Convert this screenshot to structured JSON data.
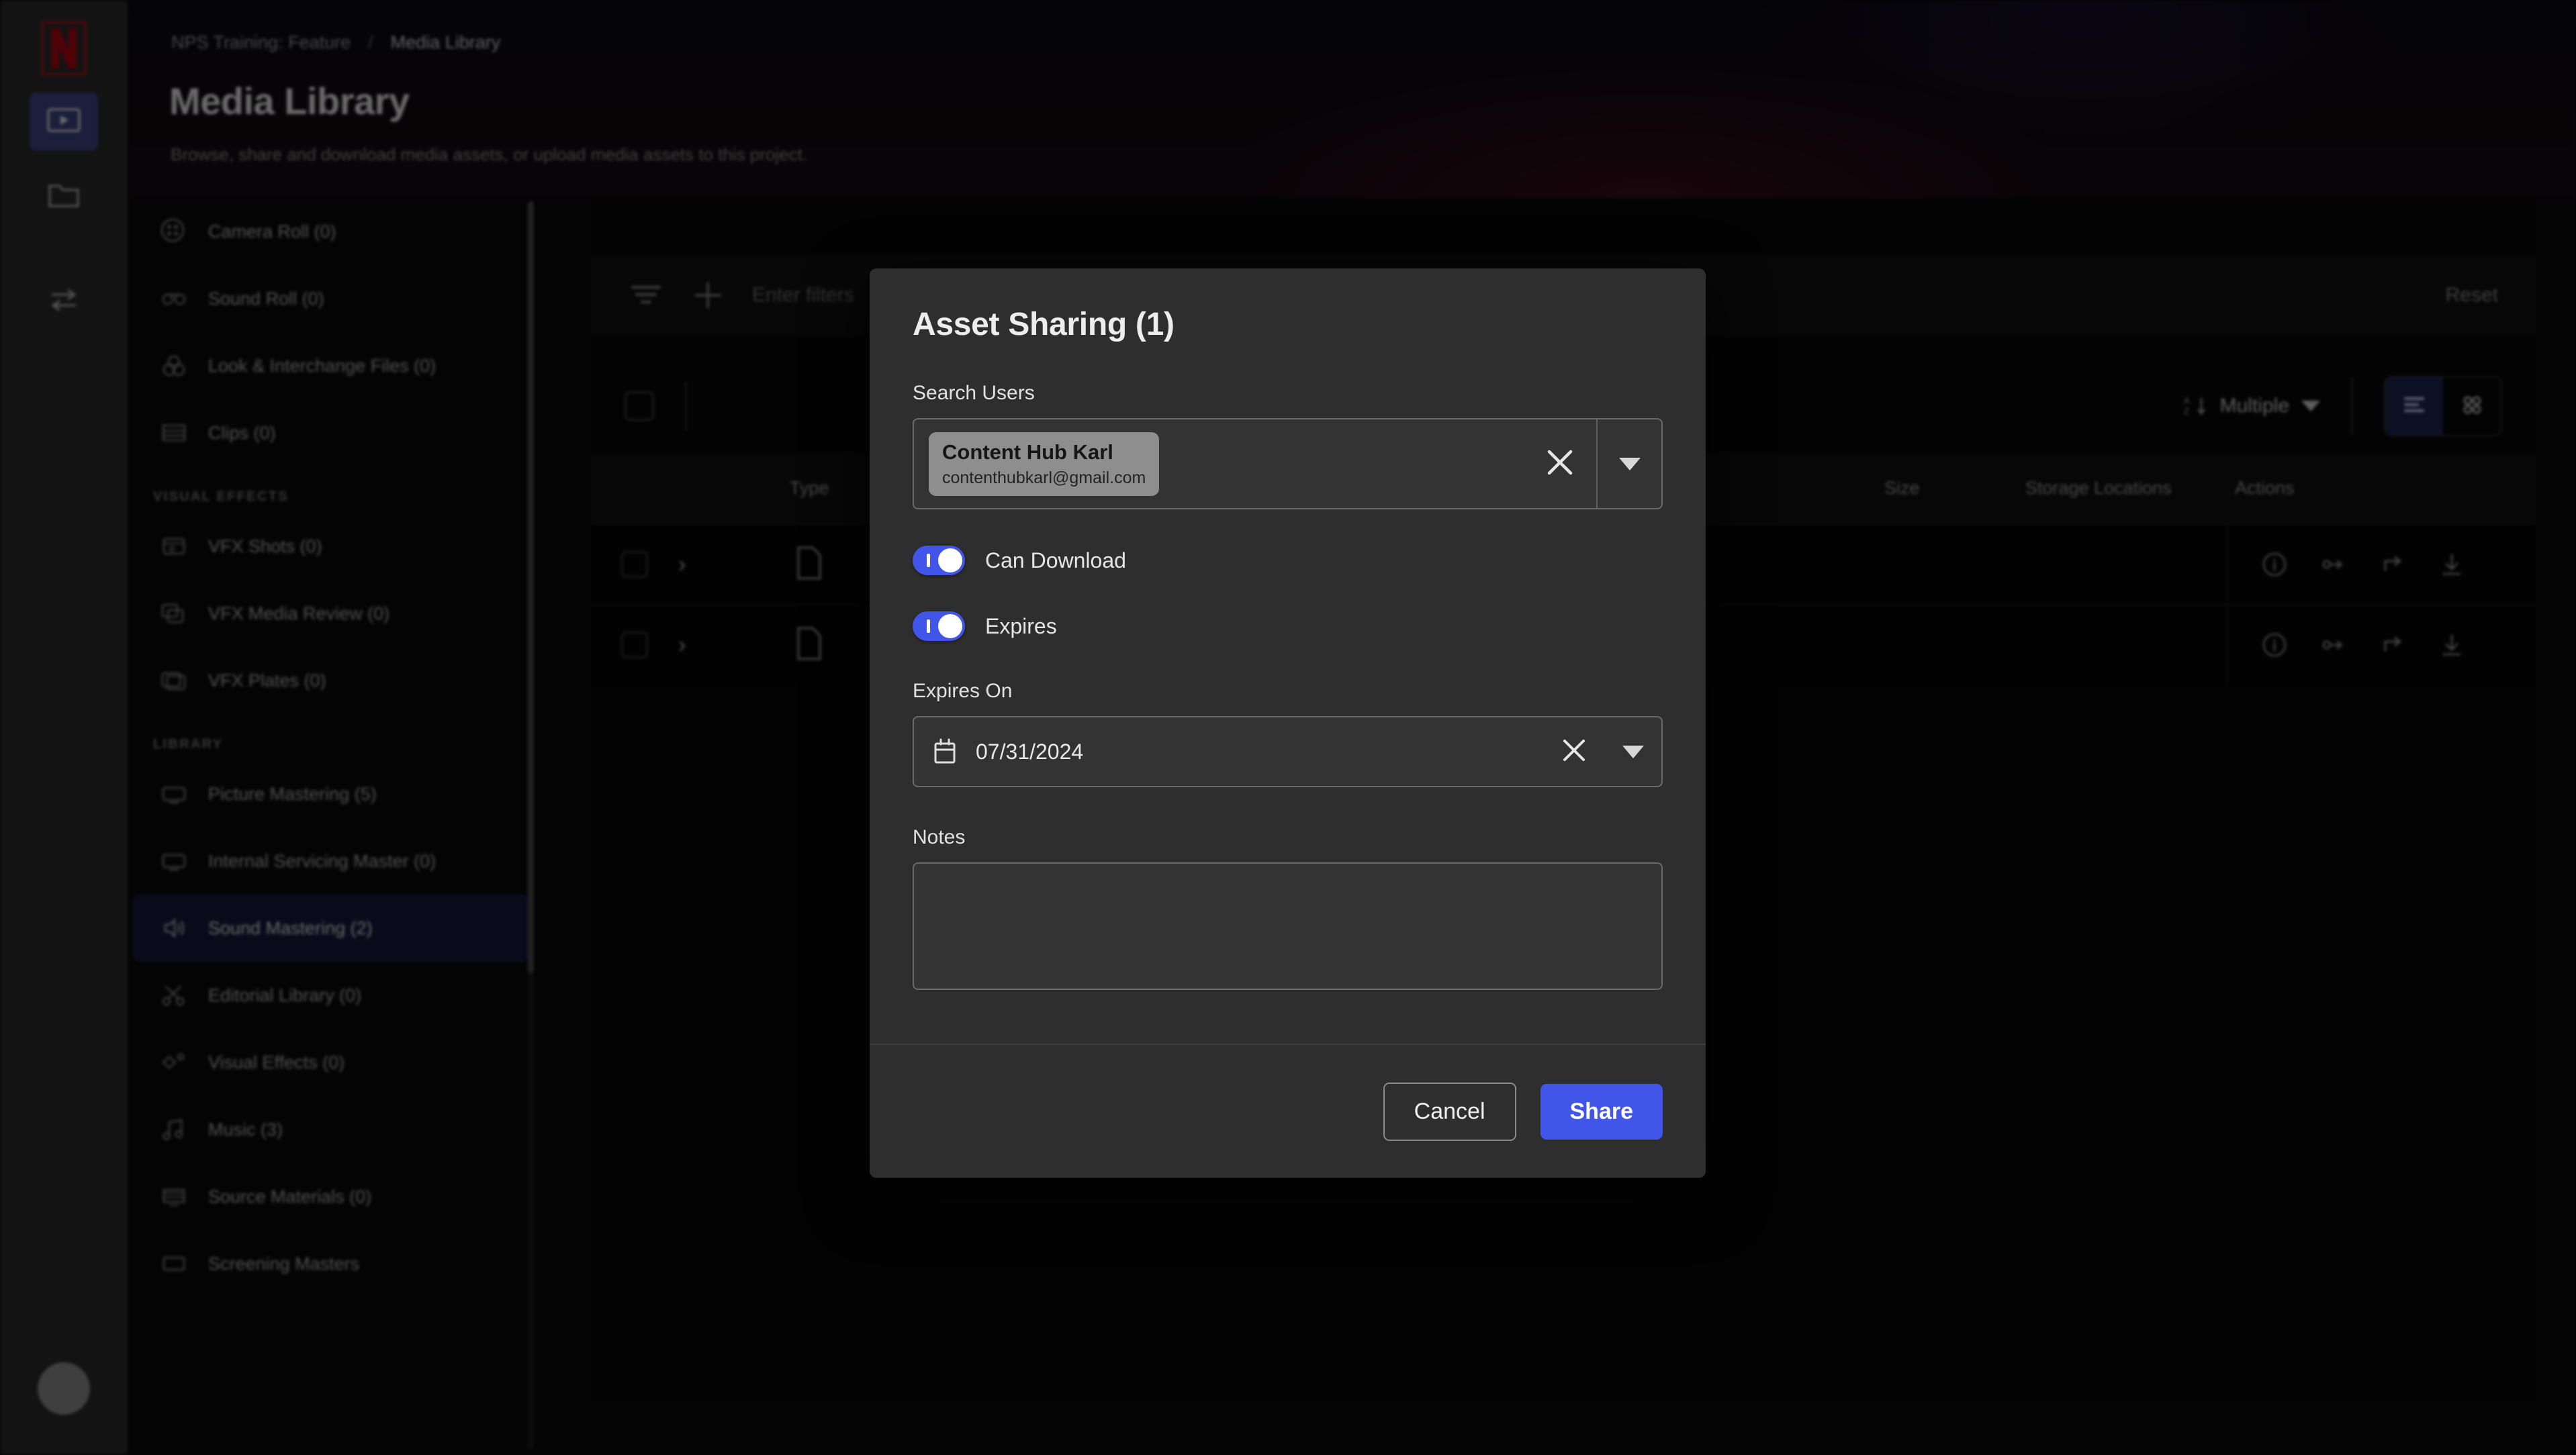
{
  "rail": {
    "logo": "netflix-logo",
    "items": [
      {
        "icon": "media-play-icon",
        "active": true
      },
      {
        "icon": "folder-icon",
        "active": false
      },
      {
        "icon": "transfer-icon",
        "active": false
      }
    ],
    "avatar": "user-avatar"
  },
  "header": {
    "breadcrumb_project": "NPS Training: Feature",
    "breadcrumb_separator": "/",
    "breadcrumb_current": "Media Library",
    "title": "Media Library",
    "subtitle": "Browse, share and download media assets, or upload media assets to this project."
  },
  "sidebar": {
    "top_items": [
      {
        "label": "Camera Roll (0)",
        "icon": "camera-roll-icon"
      },
      {
        "label": "Sound Roll (0)",
        "icon": "sound-roll-icon"
      },
      {
        "label": "Look & Interchange Files (0)",
        "icon": "look-files-icon"
      },
      {
        "label": "Clips (0)",
        "icon": "clips-icon"
      }
    ],
    "section_vfx": "VISUAL EFFECTS",
    "vfx_items": [
      {
        "label": "VFX Shots (0)",
        "icon": "vfx-shots-icon"
      },
      {
        "label": "VFX Media Review (0)",
        "icon": "vfx-review-icon"
      },
      {
        "label": "VFX Plates (0)",
        "icon": "vfx-plates-icon"
      }
    ],
    "section_library": "LIBRARY",
    "library_items": [
      {
        "label": "Picture Mastering (5)",
        "icon": "monitor-icon",
        "active": false
      },
      {
        "label": "Internal Servicing Master (0)",
        "icon": "monitor-icon",
        "active": false
      },
      {
        "label": "Sound Mastering (2)",
        "icon": "speaker-icon",
        "active": true
      },
      {
        "label": "Editorial Library (0)",
        "icon": "scissors-icon",
        "active": false
      },
      {
        "label": "Visual Effects (0)",
        "icon": "vfx-icon",
        "active": false
      },
      {
        "label": "Music (3)",
        "icon": "music-icon",
        "active": false
      },
      {
        "label": "Source Materials (0)",
        "icon": "source-materials-icon",
        "active": false
      },
      {
        "label": "Screening Masters",
        "icon": "screening-icon",
        "active": false
      }
    ]
  },
  "toolbar": {
    "filter_icon": "filter-icon",
    "add_icon": "plus-icon",
    "filter_placeholder": "Enter filters",
    "reset_label": "Reset",
    "sort_label": "Multiple",
    "sort_icon": "sort-az-icon",
    "view_list_icon": "list-view-icon",
    "view_grid_icon": "grid-view-icon"
  },
  "table": {
    "columns": [
      "Type",
      "Size",
      "Storage Locations",
      "Actions"
    ],
    "rows": [
      {
        "type_icon": "file-icon",
        "actions": [
          "info-icon",
          "link-icon",
          "share-icon",
          "download-icon"
        ]
      },
      {
        "type_icon": "file-icon",
        "actions": [
          "info-icon",
          "link-icon",
          "share-icon",
          "download-icon"
        ]
      }
    ]
  },
  "modal": {
    "title": "Asset Sharing (1)",
    "search_users_label": "Search Users",
    "selected_user": {
      "name": "Content Hub Karl",
      "email": "contenthubkarl@gmail.com"
    },
    "clear_icon": "close-icon",
    "dropdown_icon": "chevron-down-icon",
    "can_download_label": "Can Download",
    "can_download_on": true,
    "expires_label": "Expires",
    "expires_on": true,
    "expires_on_label": "Expires On",
    "expires_date": "07/31/2024",
    "calendar_icon": "calendar-icon",
    "notes_label": "Notes",
    "notes_value": "",
    "notes_placeholder": "",
    "cancel_label": "Cancel",
    "share_label": "Share"
  },
  "colors": {
    "accent_blue": "#4155e8",
    "netflix_red": "#e50914",
    "modal_bg": "#2e2e2e",
    "active_nav": "#151a3a"
  }
}
